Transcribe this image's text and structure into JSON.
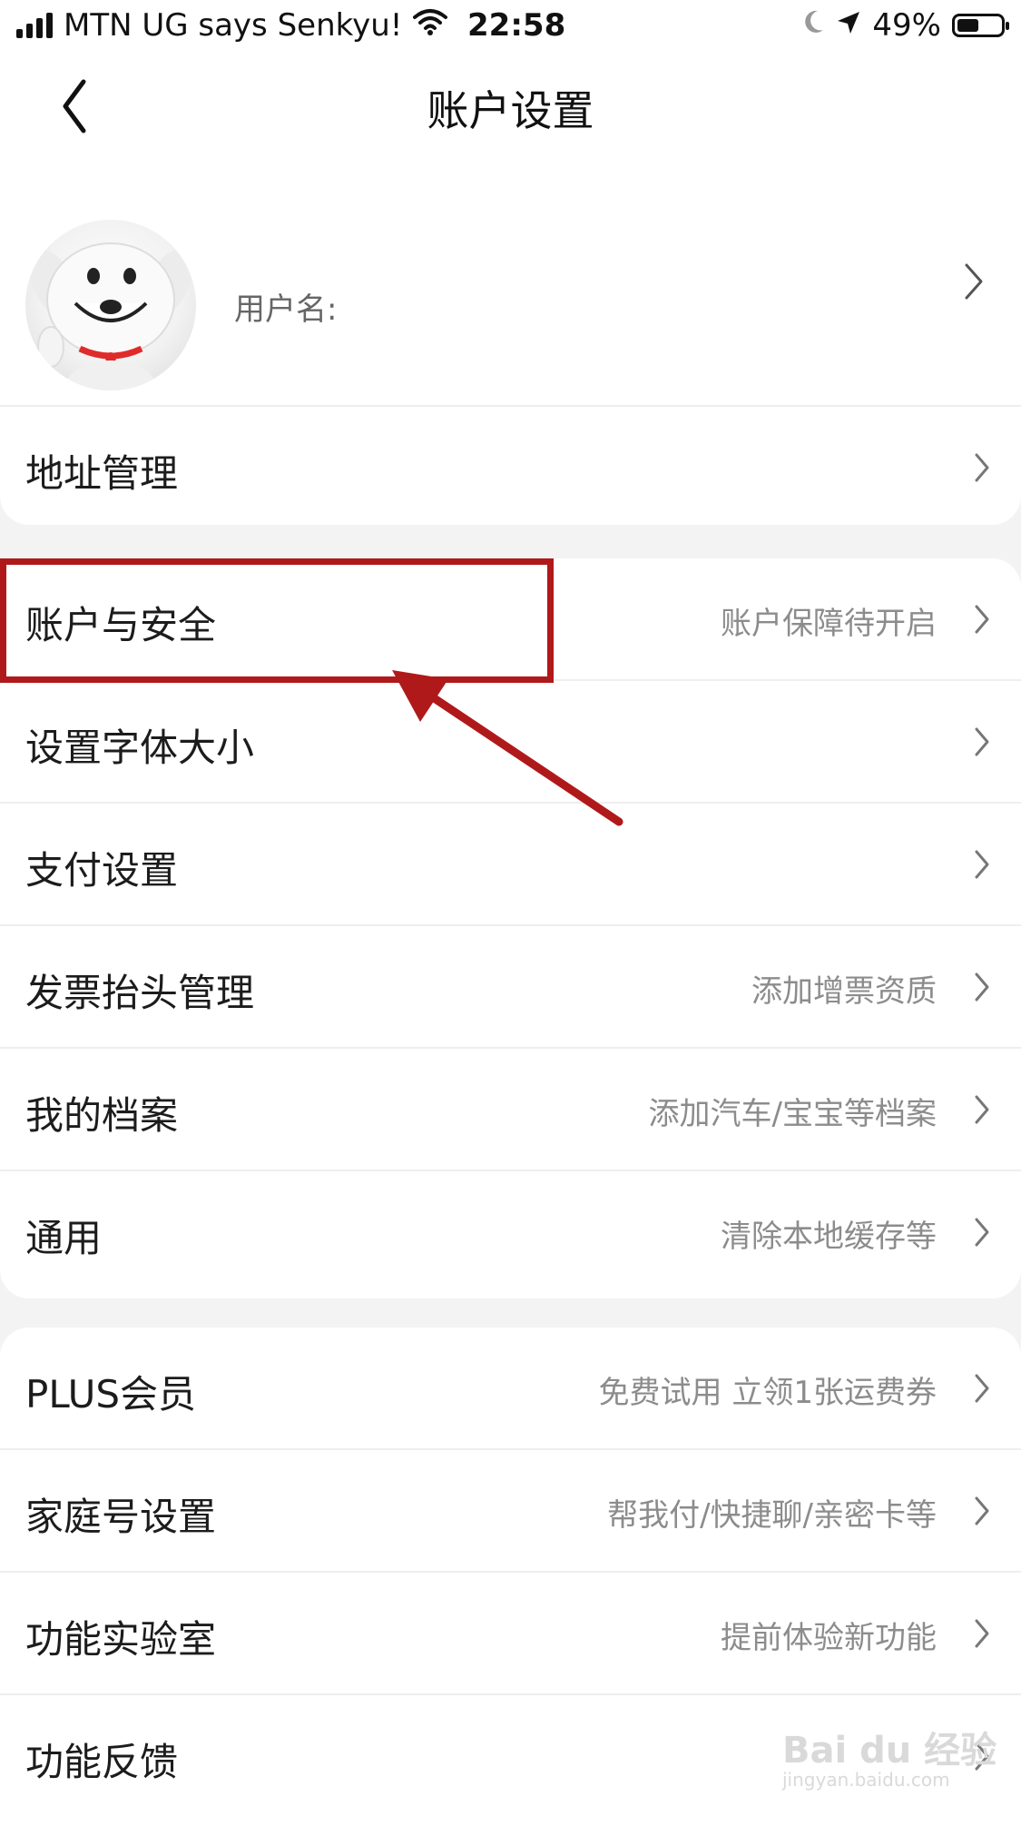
{
  "status_bar": {
    "carrier": "MTN UG says Senkyu!",
    "time": "22:58",
    "battery_percent": "49%",
    "battery_level": 0.49,
    "icons": [
      "signal-icon",
      "wifi-icon",
      "moon-icon",
      "location-icon",
      "battery-icon"
    ]
  },
  "nav": {
    "title": "账户设置",
    "back_icon": "chevron-left-icon"
  },
  "profile": {
    "username_label": "用户名:",
    "avatar_icon": "mascot-avatar"
  },
  "group1": [
    {
      "label": "地址管理",
      "value": ""
    }
  ],
  "group2": [
    {
      "label": "账户与安全",
      "value": "账户保障待开启"
    },
    {
      "label": "设置字体大小",
      "value": ""
    },
    {
      "label": "支付设置",
      "value": ""
    },
    {
      "label": "发票抬头管理",
      "value": "添加增票资质"
    },
    {
      "label": "我的档案",
      "value": "添加汽车/宝宝等档案"
    },
    {
      "label": "通用",
      "value": "清除本地缓存等"
    }
  ],
  "group3": [
    {
      "label": "PLUS会员",
      "value": "免费试用 立领1张运费券"
    },
    {
      "label": "家庭号设置",
      "value": "帮我付/快捷聊/亲密卡等"
    },
    {
      "label": "功能实验室",
      "value": "提前体验新功能"
    },
    {
      "label": "功能反馈",
      "value": ""
    }
  ],
  "watermark": {
    "text": "Bai du 经验",
    "sub": "jingyan.baidu.com"
  },
  "colors": {
    "highlight": "#b0191a",
    "background": "#f3f3f3",
    "secondary_text": "#8c8c8c"
  }
}
